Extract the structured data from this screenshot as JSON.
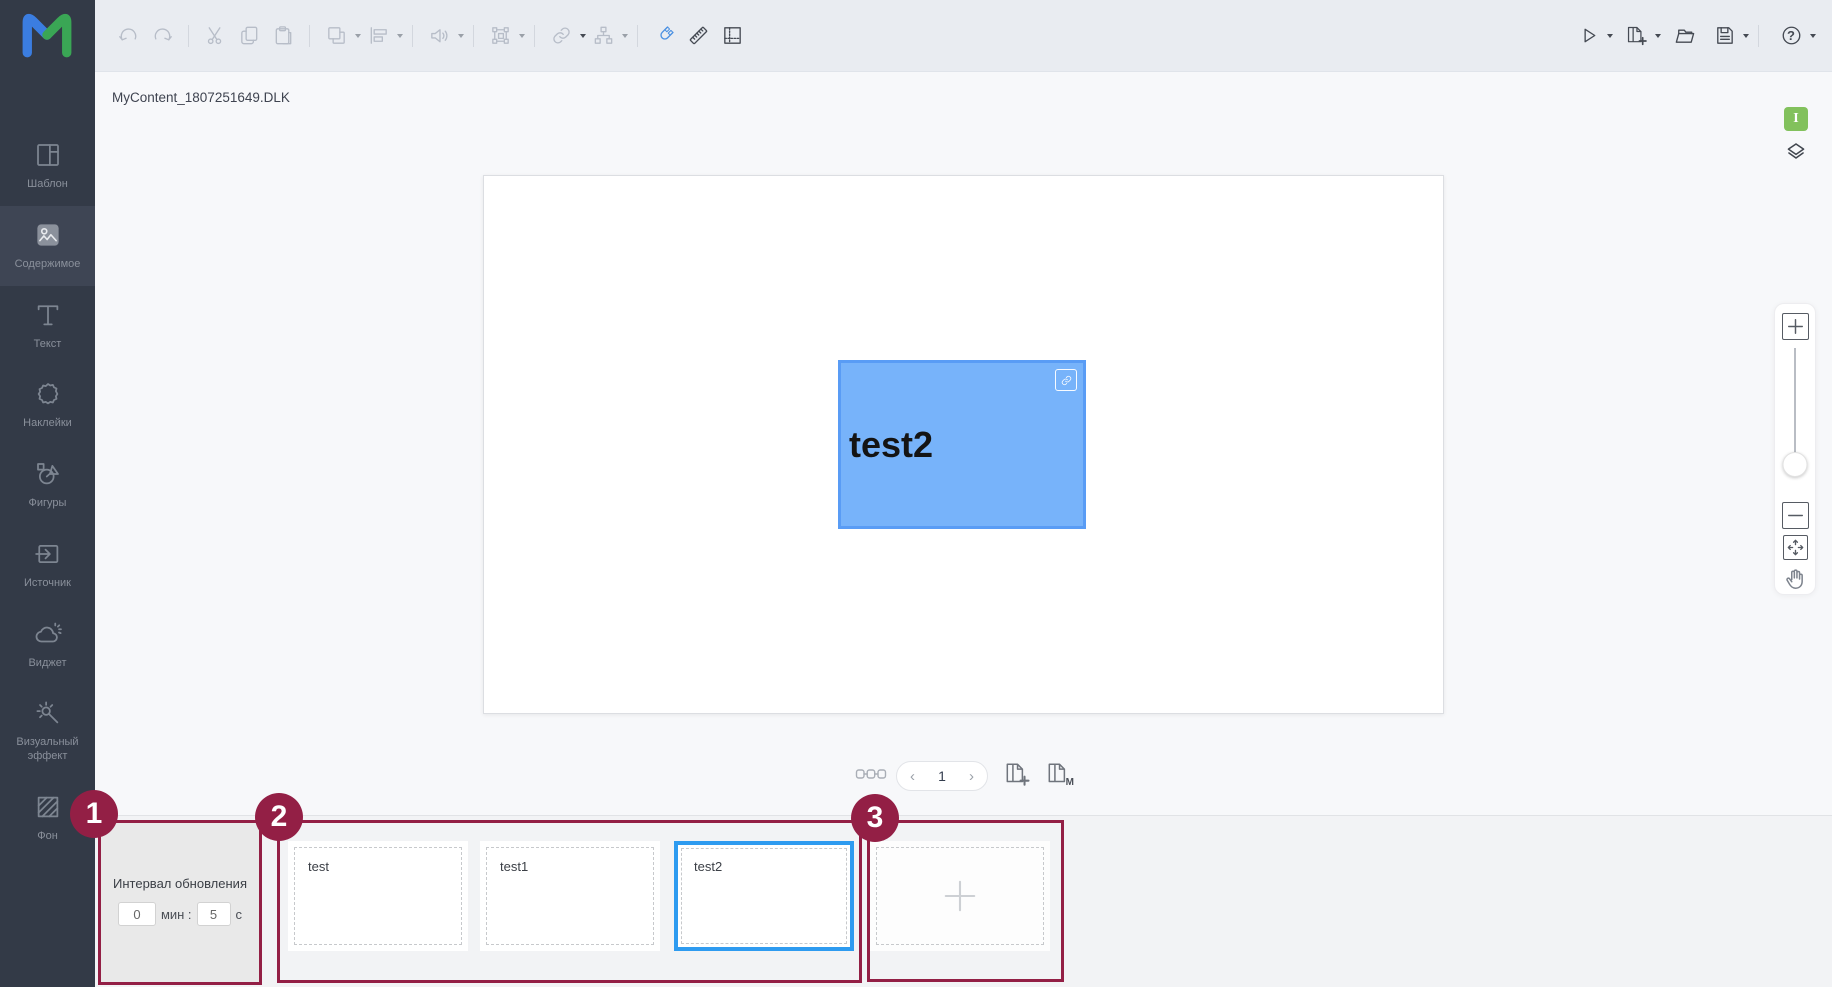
{
  "header": {
    "filename": "MyContent_1807251649.DLK"
  },
  "colors": {
    "sidebar_bg": "#333a47",
    "toolbar_bg": "#e9ecf1",
    "accent_blue": "#4a90e2",
    "element_fill": "#77b3fa",
    "element_border": "#599cf5",
    "selection_blue": "#2e9bf0",
    "annotation_red": "#931f45",
    "badge_green": "#82c15c",
    "strip_bg": "#f2f3f5"
  },
  "toolbar": {
    "left_icons": [
      "undo",
      "redo",
      "cut",
      "copy",
      "paste",
      "group",
      "align",
      "audio",
      "transform",
      "link",
      "hierarchy",
      "snap-magnet",
      "ruler",
      "guides"
    ],
    "right_icons": [
      "play",
      "add-window",
      "open-folder",
      "save",
      "help"
    ],
    "help_glyph": "?"
  },
  "sidebar": {
    "items": [
      {
        "label": "Шаблон",
        "icon": "template-icon",
        "active": false
      },
      {
        "label": "Содержимое",
        "icon": "content-icon",
        "active": true
      },
      {
        "label": "Текст",
        "icon": "text-icon",
        "active": false
      },
      {
        "label": "Наклейки",
        "icon": "stickers-icon",
        "active": false
      },
      {
        "label": "Фигуры",
        "icon": "shapes-icon",
        "active": false
      },
      {
        "label": "Источник",
        "icon": "source-icon",
        "active": false
      },
      {
        "label": "Виджет",
        "icon": "widget-icon",
        "active": false
      },
      {
        "label": "Визуальный эффект",
        "icon": "visual-effect-icon",
        "active": false
      },
      {
        "label": "Фон",
        "icon": "background-icon",
        "active": false
      }
    ]
  },
  "canvas": {
    "element_label": "test2",
    "element_badge_icon": "link-icon"
  },
  "right_tools": {
    "badge": "I"
  },
  "pagination": {
    "prev": "‹",
    "current_page": "1",
    "next": "›"
  },
  "page_actions": {
    "m_label": "M"
  },
  "interval_panel": {
    "title": "Интервал обновления",
    "minutes": "0",
    "minutes_label": "мин :",
    "seconds": "5",
    "seconds_label": "с"
  },
  "filmstrip": {
    "pages": [
      {
        "label": "test",
        "selected": false
      },
      {
        "label": "test1",
        "selected": false
      },
      {
        "label": "test2",
        "selected": true
      }
    ]
  },
  "annotations": {
    "markers": [
      "1",
      "2",
      "3"
    ]
  }
}
